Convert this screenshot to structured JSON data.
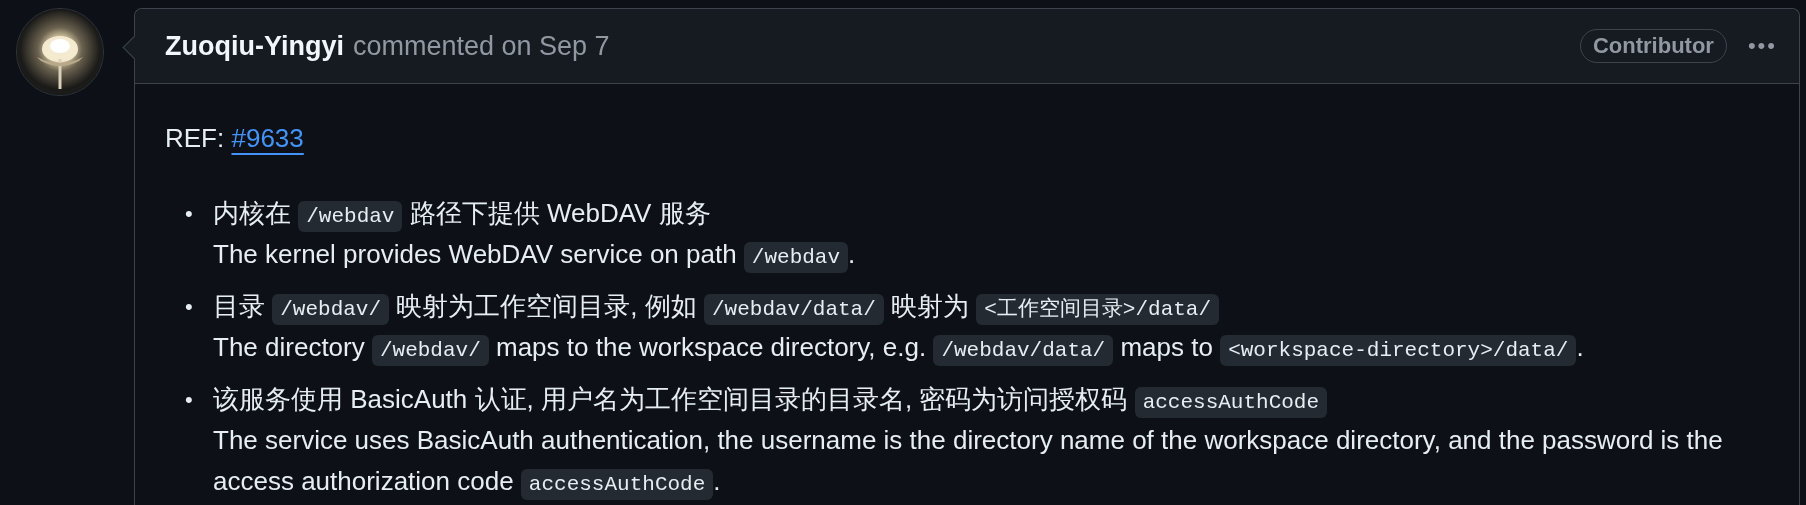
{
  "comment": {
    "author": "Zuoqiu-Yingyi",
    "action": "commented on Sep 7",
    "badge": "Contributor",
    "menu": "•••",
    "ref": {
      "label": "REF:",
      "link": "#9633"
    },
    "items": [
      {
        "bullet": "•",
        "lines": [
          [
            {
              "kind": "text",
              "text": "内核在 "
            },
            {
              "kind": "code",
              "text": "/webdav"
            },
            {
              "kind": "text",
              "text": " 路径下提供 WebDAV 服务"
            }
          ],
          [
            {
              "kind": "text",
              "text": "The kernel provides WebDAV service on path "
            },
            {
              "kind": "code",
              "text": "/webdav"
            },
            {
              "kind": "text",
              "text": "."
            }
          ]
        ]
      },
      {
        "bullet": "•",
        "lines": [
          [
            {
              "kind": "text",
              "text": "目录 "
            },
            {
              "kind": "code",
              "text": "/webdav/"
            },
            {
              "kind": "text",
              "text": " 映射为工作空间目录, 例如 "
            },
            {
              "kind": "code",
              "text": "/webdav/data/"
            },
            {
              "kind": "text",
              "text": " 映射为 "
            },
            {
              "kind": "code",
              "text": "<工作空间目录>/data/"
            }
          ],
          [
            {
              "kind": "text",
              "text": "The directory "
            },
            {
              "kind": "code",
              "text": "/webdav/"
            },
            {
              "kind": "text",
              "text": " maps to the workspace directory, e.g. "
            },
            {
              "kind": "code",
              "text": "/webdav/data/"
            },
            {
              "kind": "text",
              "text": " maps to "
            },
            {
              "kind": "code",
              "text": "<workspace-directory>/data/"
            },
            {
              "kind": "text",
              "text": "."
            }
          ]
        ]
      },
      {
        "bullet": "•",
        "lines": [
          [
            {
              "kind": "text",
              "text": "该服务使用 BasicAuth 认证, 用户名为工作空间目录的目录名, 密码为访问授权码 "
            },
            {
              "kind": "code",
              "text": "accessAuthCode"
            }
          ],
          [
            {
              "kind": "text",
              "text": "The service uses BasicAuth authentication, the username is the directory name of the workspace directory, and the password is the access authorization code "
            },
            {
              "kind": "code",
              "text": "accessAuthCode"
            },
            {
              "kind": "text",
              "text": "."
            }
          ]
        ]
      }
    ]
  }
}
